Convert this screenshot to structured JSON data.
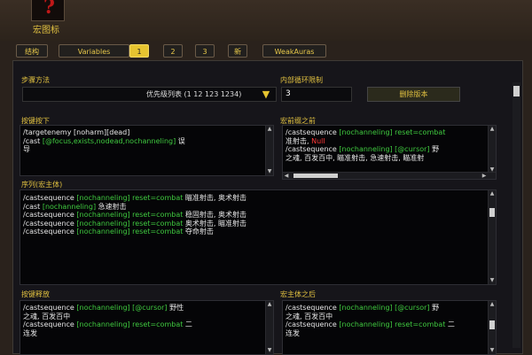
{
  "header": {
    "icon_glyph": "?",
    "icon_label": "宏图标"
  },
  "tabs": [
    {
      "label": "结构",
      "active": false
    },
    {
      "label": "Variables",
      "active": false
    },
    {
      "label": "1",
      "active": true
    },
    {
      "label": "2",
      "active": false
    },
    {
      "label": "3",
      "active": false
    },
    {
      "label": "新",
      "active": false
    },
    {
      "label": "WeakAuras",
      "active": false
    }
  ],
  "step": {
    "label": "步骤方法",
    "value": "优先级列表 (1 12 123 1234)"
  },
  "inner_loop": {
    "label": "内部循环限制",
    "value": "3"
  },
  "delete_button": "删除版本",
  "boxes": {
    "keypress": {
      "label": "按键按下",
      "lines": [
        [
          {
            "t": "/targetenemy [noharm][dead]",
            "c": "w"
          }
        ],
        [
          {
            "t": "/cast ",
            "c": "w"
          },
          {
            "t": "[@focus,exists,nodead,nochanneling]",
            "c": "g"
          },
          {
            "t": " 误",
            "c": "w"
          }
        ],
        [
          {
            "t": "导",
            "c": "w"
          }
        ]
      ]
    },
    "prefix": {
      "label": "宏前缀之前",
      "lines": [
        [
          {
            "t": "/castsequence ",
            "c": "w"
          },
          {
            "t": "[nochanneling] reset=combat",
            "c": "g"
          }
        ],
        [
          {
            "t": "准射击, ",
            "c": "w"
          },
          {
            "t": "Null",
            "c": "r"
          }
        ],
        [
          {
            "t": "/castsequence ",
            "c": "w"
          },
          {
            "t": "[nochanneling] [@cursor]",
            "c": "g"
          },
          {
            "t": " 野",
            "c": "w"
          }
        ],
        [
          {
            "t": "之魂, 百发百中, 瞄准射击, 急速射击, 瞄准射",
            "c": "w"
          }
        ]
      ]
    },
    "sequence": {
      "label": "序列(宏主体)",
      "lines": [
        [
          {
            "t": "/castsequence ",
            "c": "w"
          },
          {
            "t": "[nochanneling] reset=combat",
            "c": "g"
          },
          {
            "t": " 瞄准射击, 奥术射击",
            "c": "w"
          }
        ],
        [
          {
            "t": "/cast ",
            "c": "w"
          },
          {
            "t": "[nochanneling]",
            "c": "g"
          },
          {
            "t": " 急速射击",
            "c": "w"
          }
        ],
        [
          {
            "t": "/castsequence ",
            "c": "w"
          },
          {
            "t": "[nochanneling] reset=combat",
            "c": "g"
          },
          {
            "t": " 稳固射击, 奥术射击",
            "c": "w"
          }
        ],
        [
          {
            "t": "/castsequence ",
            "c": "w"
          },
          {
            "t": "[nochanneling] reset=combat",
            "c": "g"
          },
          {
            "t": " 奥术射击, 瞄准射击",
            "c": "w"
          }
        ],
        [
          {
            "t": "/castsequence ",
            "c": "w"
          },
          {
            "t": "[nochanneling] reset=combat",
            "c": "g"
          },
          {
            "t": " 夺命射击",
            "c": "w"
          }
        ]
      ]
    },
    "release": {
      "label": "按键释放",
      "lines": [
        [
          {
            "t": "/castsequence ",
            "c": "w"
          },
          {
            "t": "[nochanneling] [@cursor]",
            "c": "g"
          },
          {
            "t": " 野性",
            "c": "w"
          }
        ],
        [
          {
            "t": "之魂, 百发百中",
            "c": "w"
          }
        ],
        [
          {
            "t": "/castsequence ",
            "c": "w"
          },
          {
            "t": "[nochanneling] reset=combat",
            "c": "g"
          },
          {
            "t": " 二",
            "c": "w"
          }
        ],
        [
          {
            "t": "连发",
            "c": "w"
          }
        ]
      ]
    },
    "suffix": {
      "label": "宏主体之后",
      "lines": [
        [
          {
            "t": "/castsequence ",
            "c": "w"
          },
          {
            "t": "[nochanneling] [@cursor]",
            "c": "g"
          },
          {
            "t": " 野",
            "c": "w"
          }
        ],
        [
          {
            "t": "之魂, 百发百中",
            "c": "w"
          }
        ],
        [
          {
            "t": "/castsequence ",
            "c": "w"
          },
          {
            "t": "[nochanneling] reset=combat",
            "c": "g"
          },
          {
            "t": " 二",
            "c": "w"
          }
        ],
        [
          {
            "t": "连发",
            "c": "w"
          }
        ]
      ]
    }
  },
  "colors": {
    "label_gold": "#e0c040",
    "code_green": "#3fc93f",
    "code_white": "#e6e6e6",
    "code_red": "#ff3838",
    "tab_active": "#e6c430"
  },
  "icons": {
    "dropdown": "chevron-down-icon",
    "scroll_up": "triangle-up-icon",
    "scroll_down": "triangle-down-icon",
    "scroll_left": "triangle-left-icon",
    "scroll_right": "triangle-right-icon"
  }
}
